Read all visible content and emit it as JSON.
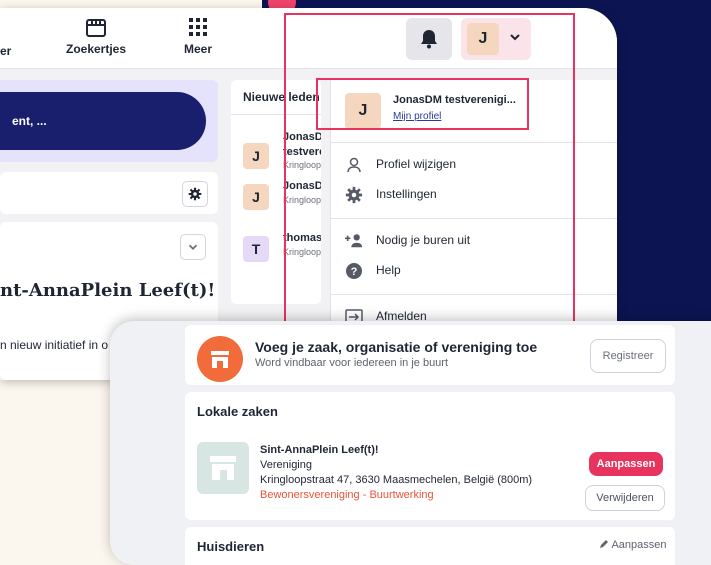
{
  "nav": {
    "partial_label": "er",
    "zoekertjes_label": "Zoekertjes",
    "meer_label": "Meer",
    "avatar_initial": "J"
  },
  "left": {
    "pill_text": "ent, ...",
    "card_title": "nt-AnnaPlein Leef(t)!",
    "card_text": "n nieuw initiatief in o"
  },
  "members": {
    "heading": "Nieuwe leden",
    "rows": [
      {
        "initial": "J",
        "name_line1": "JonasDM",
        "name_line2": "testveren",
        "sub": "Kringloops",
        "color": "#f5d7bf"
      },
      {
        "initial": "J",
        "name_line1": "JonasDM",
        "name_line2": "",
        "sub": "Kringloops",
        "color": "#f5d7bf"
      },
      {
        "initial": "T",
        "name_line1": "thomas p",
        "name_line2": "",
        "sub": "Kringloops",
        "color": "#e6d9f7"
      }
    ]
  },
  "dropdown": {
    "user_initial": "J",
    "user_name": "JonasDM testverenigi...",
    "profile_link": "Mijn profiel",
    "items": [
      {
        "label": "Profiel wijzigen",
        "icon": "person-icon"
      },
      {
        "label": "Instellingen",
        "icon": "gear-icon"
      },
      {
        "label": "Nodig je buren uit",
        "icon": "person-add-icon"
      },
      {
        "label": "Help",
        "icon": "help-icon"
      },
      {
        "label": "Afmelden",
        "icon": "logout-icon"
      }
    ]
  },
  "business_cta": {
    "title": "Voeg je zaak, organisatie of vereniging toe",
    "subtitle": "Word vindbaar voor iedereen in je buurt",
    "button": "Registreer"
  },
  "local": {
    "heading": "Lokale zaken",
    "name": "Sint-AnnaPlein Leef(t)!",
    "type": "Vereniging",
    "address": "Kringloopstraat 47, 3630 Maasmechelen, België (800m)",
    "category": "Bewonersvereniging - Buurtwerking",
    "edit_button": "Aanpassen",
    "remove_button": "Verwijderen"
  },
  "pets": {
    "heading": "Huisdieren",
    "edit_link": "Aanpassen"
  },
  "colors": {
    "navy": "#0c1552",
    "accent_red": "#e8335f",
    "orange": "#f26b3a"
  }
}
